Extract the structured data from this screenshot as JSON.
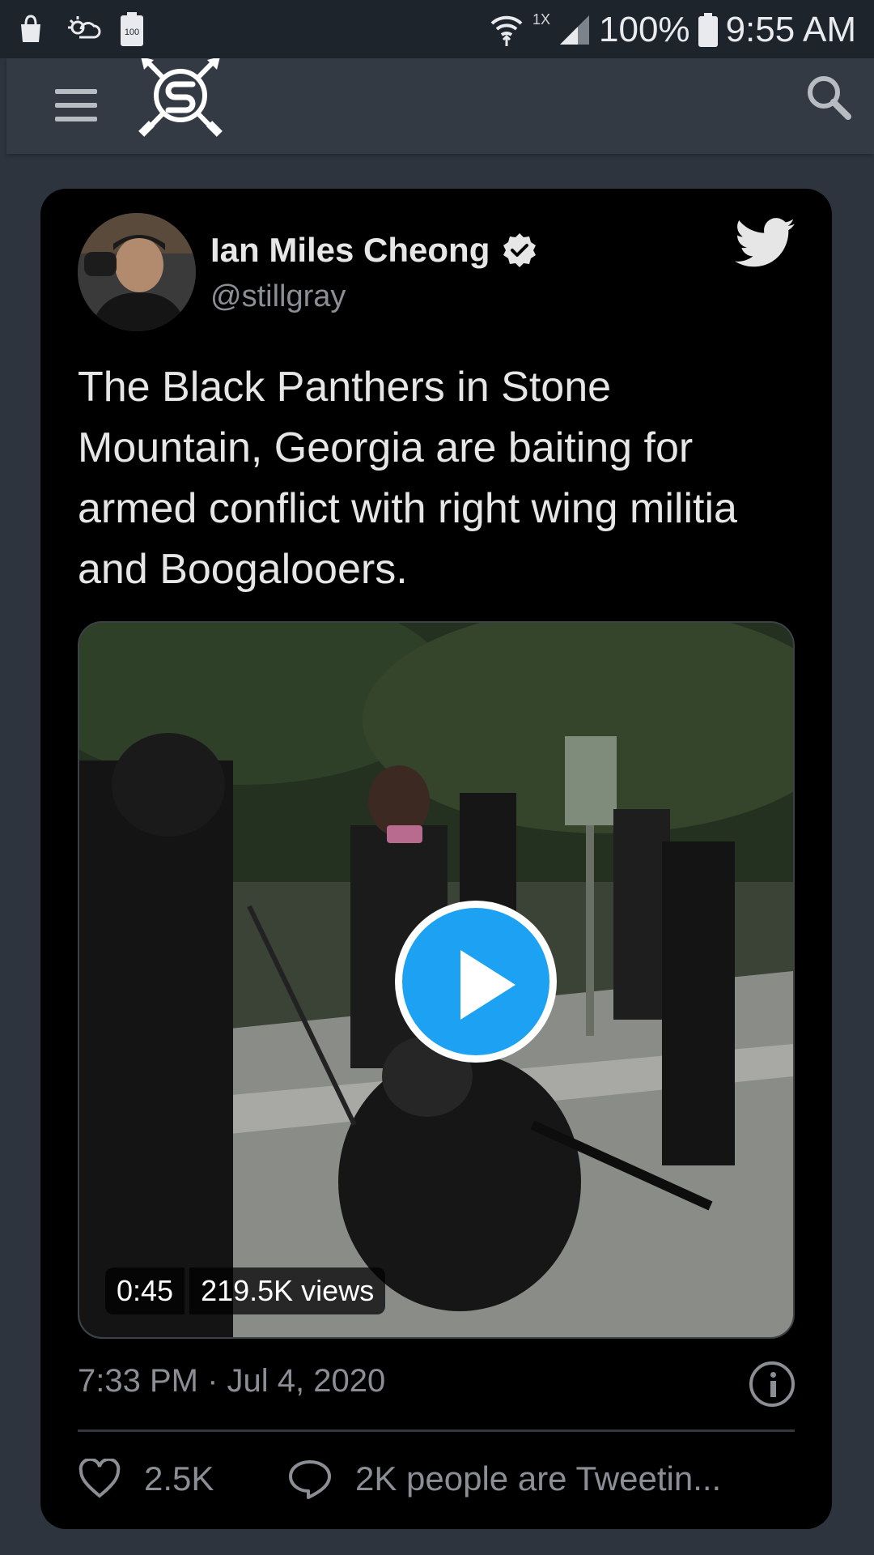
{
  "status_bar": {
    "battery_percent": "100%",
    "time": "9:55 AM",
    "wifi_speed": "1X",
    "battery_small": "100"
  },
  "app_bar": {
    "menu_icon": "hamburger-menu-icon",
    "logo_icon": "app-logo-icon",
    "search_icon": "search-icon"
  },
  "tweet": {
    "author_name": "Ian Miles Cheong",
    "handle": "@stillgray",
    "verified": true,
    "text": "The Black Panthers in Stone Mountain, Georgia are baiting for armed conflict with right wing militia and Boogalooers.",
    "media": {
      "duration": "0:45",
      "views": "219.5K views"
    },
    "timestamp": "7:33 PM · Jul 4, 2020",
    "likes": "2.5K",
    "discussion": "2K people are Tweetin..."
  },
  "colors": {
    "accent": "#1da1f2",
    "background": "#2d343e",
    "card": "#000000",
    "secondary_text": "#8b8f95"
  }
}
